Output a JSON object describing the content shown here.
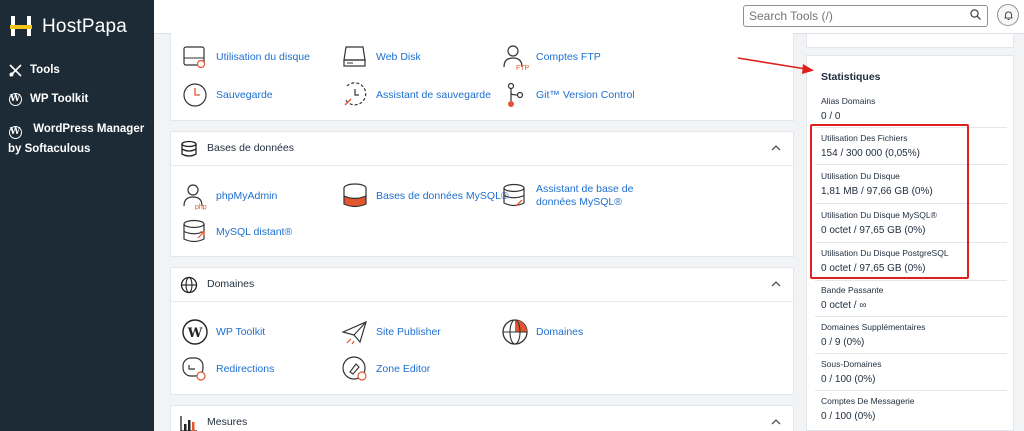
{
  "brand": {
    "name": "HostPapa"
  },
  "sidebar": {
    "items": [
      {
        "label": "Tools",
        "icon": "tools-icon"
      },
      {
        "label": "WP Toolkit",
        "icon": "wordpress-icon"
      },
      {
        "label": "WordPress Manager by Softaculous",
        "icon": "wordpress-icon"
      }
    ]
  },
  "search": {
    "placeholder": "Search Tools (/)"
  },
  "files_panel": {
    "tools": [
      {
        "label": "Utilisation du disque",
        "icon": "disk-usage-icon"
      },
      {
        "label": "Web Disk",
        "icon": "web-disk-icon"
      },
      {
        "label": "Comptes FTP",
        "icon": "ftp-accounts-icon"
      },
      {
        "label": "Sauvegarde",
        "icon": "backup-icon"
      },
      {
        "label": "Assistant de sauvegarde",
        "icon": "backup-wizard-icon"
      },
      {
        "label": "Git™ Version Control",
        "icon": "git-icon"
      }
    ]
  },
  "databases_panel": {
    "title": "Bases de données",
    "tools": [
      {
        "label": "phpMyAdmin",
        "icon": "phpmyadmin-icon"
      },
      {
        "label": "Bases de données MySQL®",
        "icon": "mysql-databases-icon"
      },
      {
        "label": "Assistant de base de données MySQL®",
        "icon": "mysql-wizard-icon"
      },
      {
        "label": "MySQL distant®",
        "icon": "remote-mysql-icon"
      }
    ]
  },
  "domains_panel": {
    "title": "Domaines",
    "tools": [
      {
        "label": "WP Toolkit",
        "icon": "wordpress-icon"
      },
      {
        "label": "Site Publisher",
        "icon": "site-publisher-icon"
      },
      {
        "label": "Domaines",
        "icon": "domains-icon"
      },
      {
        "label": "Redirections",
        "icon": "redirects-icon"
      },
      {
        "label": "Zone Editor",
        "icon": "zone-editor-icon"
      }
    ]
  },
  "metrics_panel": {
    "title": "Mesures"
  },
  "stats": {
    "title": "Statistiques",
    "rows": [
      {
        "label": "Alias Domains",
        "value": "0 / 0"
      },
      {
        "label": "Utilisation Des Fichiers",
        "value": "154 / 300 000   (0,05%)"
      },
      {
        "label": "Utilisation Du Disque",
        "value": "1,81 MB / 97,66 GB   (0%)"
      },
      {
        "label": "Utilisation Du Disque MySQL®",
        "value": "0 octet / 97,65 GB   (0%)"
      },
      {
        "label": "Utilisation Du Disque PostgreSQL",
        "value": "0 octet / 97,65 GB   (0%)"
      },
      {
        "label": "Bande Passante",
        "value": "0 octet / ∞"
      },
      {
        "label": "Domaines Supplémentaires",
        "value": "0 / 9   (0%)"
      },
      {
        "label": "Sous-Domaines",
        "value": "0 / 100   (0%)"
      },
      {
        "label": "Comptes De Messagerie",
        "value": "0 / 100   (0%)"
      }
    ]
  },
  "colors": {
    "sidebar_bg": "#1d2b36",
    "link": "#1d6fd1",
    "accent_orange": "#e4572e",
    "highlight_red": "#e0201e"
  }
}
